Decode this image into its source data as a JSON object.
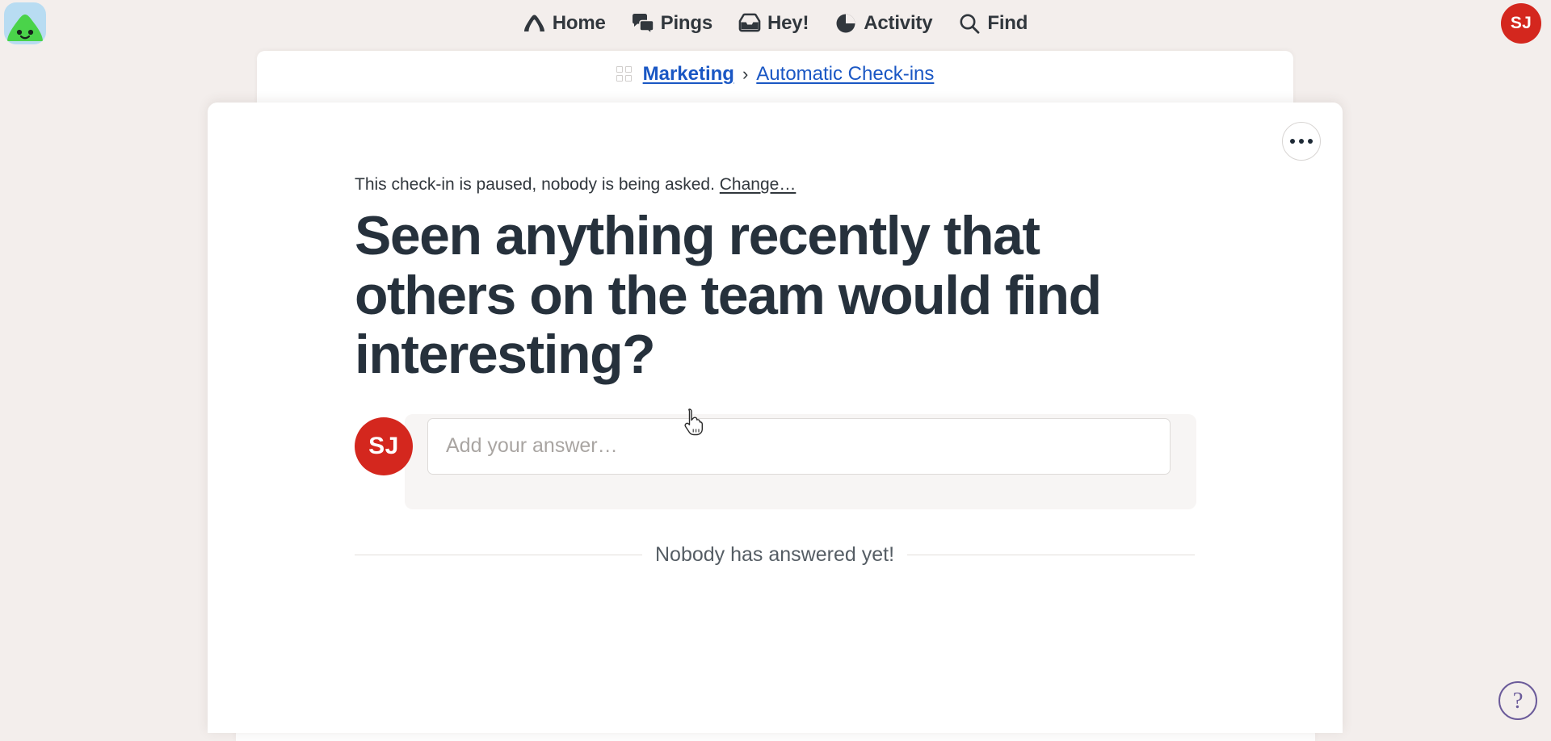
{
  "app": {
    "logo_icon": "basecamp-logo-icon",
    "background_color": "#f3eeec"
  },
  "topnav": {
    "items": [
      {
        "label": "Home",
        "icon": "home-icon"
      },
      {
        "label": "Pings",
        "icon": "chat-bubbles-icon"
      },
      {
        "label": "Hey!",
        "icon": "inbox-tray-icon"
      },
      {
        "label": "Activity",
        "icon": "pie-clock-icon"
      },
      {
        "label": "Find",
        "icon": "magnifier-icon"
      }
    ],
    "account_avatar": {
      "initials": "SJ",
      "color": "#d4271e"
    }
  },
  "breadcrumb": {
    "grid_icon": "grid-squares-icon",
    "project": "Marketing",
    "separator": "›",
    "tool": "Automatic Check-ins",
    "link_color": "#1a57c4"
  },
  "card": {
    "more_button_label": "•••",
    "status_text": "This check-in is paused, nobody is being asked.",
    "status_link": "Change…",
    "question": "Seen anything recently that others on the team would find interesting?",
    "answer": {
      "avatar_initials": "SJ",
      "avatar_color": "#d4271e",
      "placeholder": "Add your answer…",
      "value": ""
    },
    "empty_state": "Nobody has answered yet!"
  },
  "help": {
    "label": "?",
    "color": "#6b5b9a"
  }
}
